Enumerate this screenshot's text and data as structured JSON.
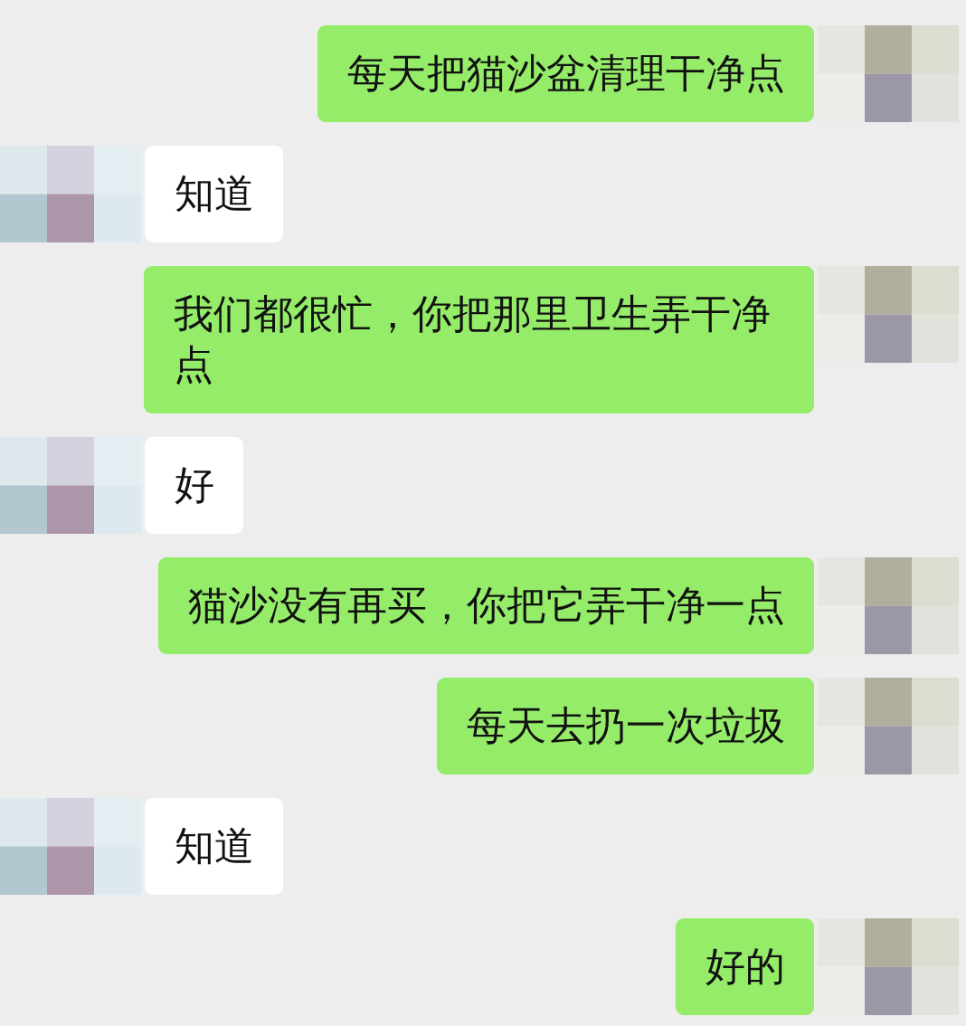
{
  "messages": [
    {
      "kind": "sent",
      "text": "每天把猫沙盆清理干净点"
    },
    {
      "kind": "received",
      "text": "知道"
    },
    {
      "kind": "sent",
      "text": "我们都很忙，你把那里卫生弄干净点"
    },
    {
      "kind": "received",
      "text": "好"
    },
    {
      "kind": "sent",
      "text": "猫沙没有再买，你把它弄干净一点"
    },
    {
      "kind": "sent",
      "text": "每天去扔一次垃圾"
    },
    {
      "kind": "received",
      "text": "知道"
    },
    {
      "kind": "sent",
      "text": "好的"
    }
  ]
}
